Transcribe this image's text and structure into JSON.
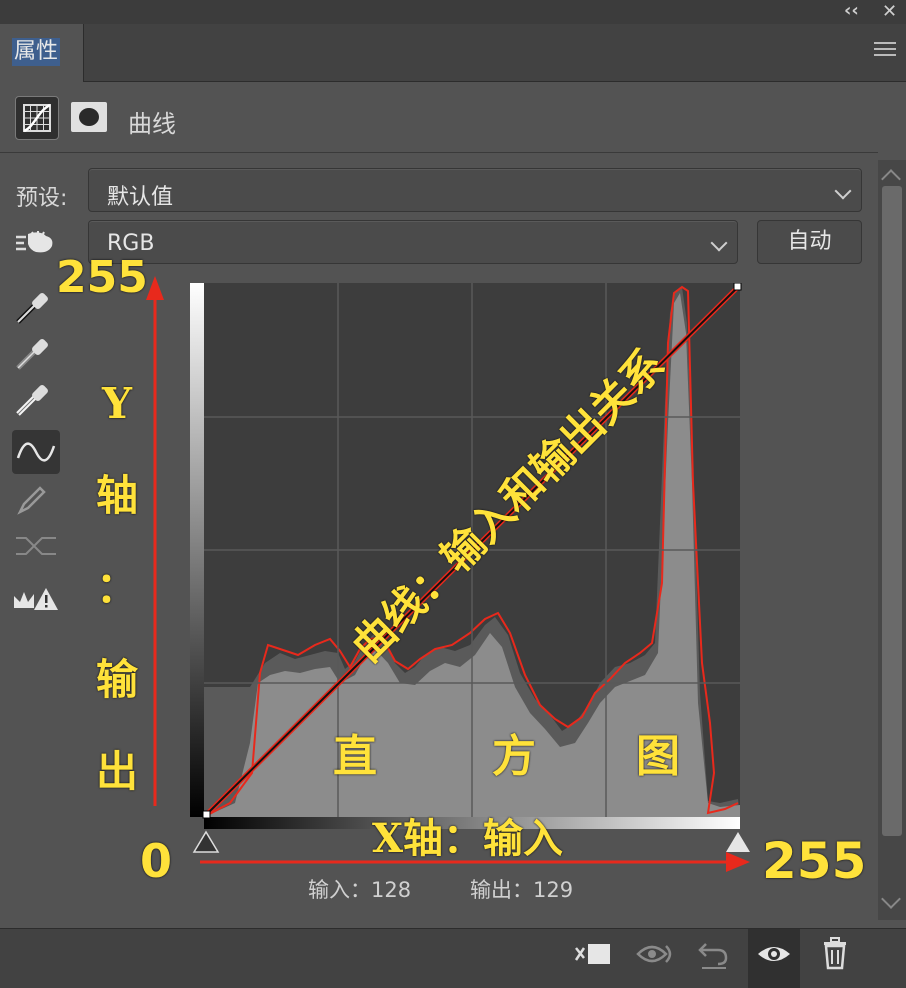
{
  "panel": {
    "tab_label": "属性",
    "collapse_glyph": "‹‹",
    "close_glyph": "✕",
    "title": "曲线"
  },
  "preset": {
    "label": "预设:",
    "value": "默认值"
  },
  "channel": {
    "value": "RGB"
  },
  "auto_label": "自动",
  "footer": {
    "input_label": "输入：128",
    "output_label": "输出：129"
  },
  "annotations": {
    "y_max": "255",
    "origin": "0",
    "x_max": "255",
    "y_axis_chars": [
      "Y",
      "轴",
      "：",
      "输",
      "出"
    ],
    "x_axis": "X轴：输入",
    "diagonal": "曲线：输入和输出关系",
    "histogram_chars": [
      "直",
      "方",
      "图"
    ]
  },
  "colors": {
    "panel_bg": "#535353",
    "graph_bg": "#3d3d3d",
    "histogram": "#8c8c8c",
    "annotation": "#ffe23a",
    "arrow": "#e8291c"
  }
}
